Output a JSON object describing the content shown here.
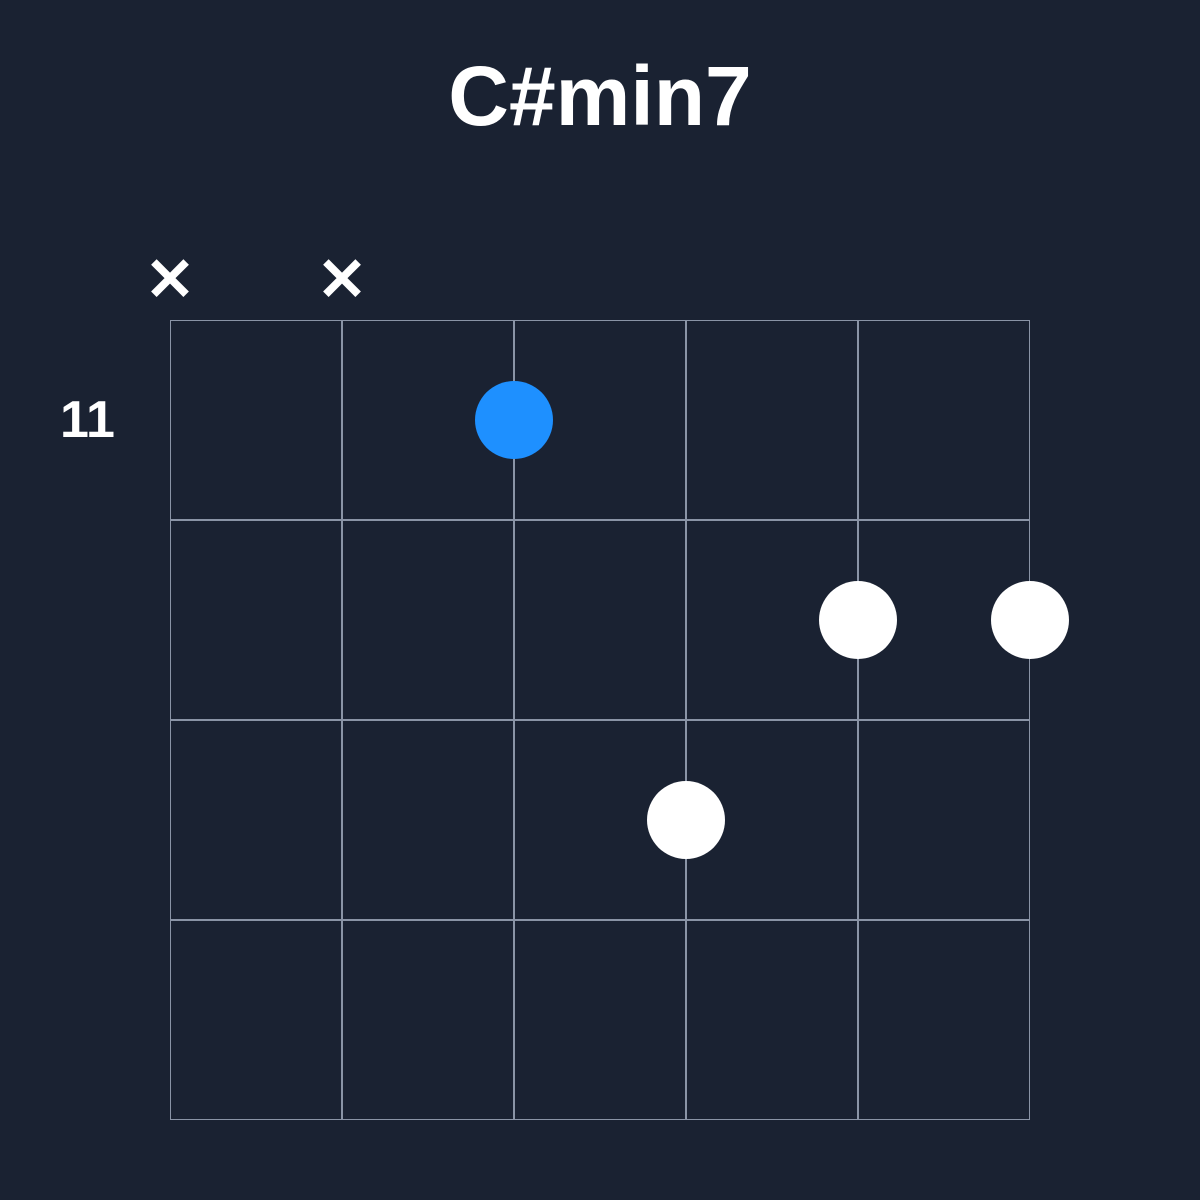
{
  "chord": {
    "name": "C#min7",
    "starting_fret": "11",
    "num_frets": 4,
    "num_strings": 6,
    "string_spacing": 172,
    "fret_spacing": 200,
    "mutes": [
      {
        "string": 1
      },
      {
        "string": 2
      }
    ],
    "dots": [
      {
        "string": 3,
        "fret": 1,
        "root": true
      },
      {
        "string": 4,
        "fret": 3,
        "root": false
      },
      {
        "string": 5,
        "fret": 2,
        "root": false
      },
      {
        "string": 6,
        "fret": 2,
        "root": false
      }
    ]
  },
  "colors": {
    "background": "#1a2232",
    "grid": "#8a94a6",
    "root_dot": "#1e90ff",
    "normal_dot": "#ffffff",
    "text": "#ffffff"
  }
}
